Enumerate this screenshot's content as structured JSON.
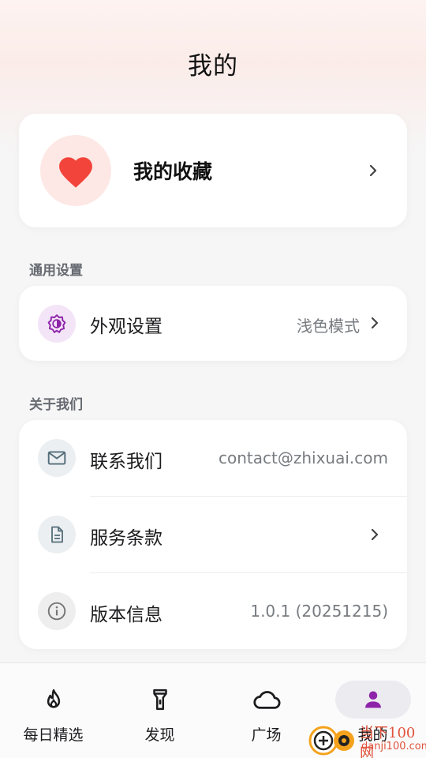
{
  "header": {
    "title": "我的"
  },
  "favorites": {
    "label": "我的收藏",
    "icon": "heart-icon",
    "accent": "#f2443a"
  },
  "general_section": {
    "title": "通用设置",
    "items": [
      {
        "label": "外观设置",
        "value": "浅色模式",
        "icon": "brightness-icon"
      }
    ]
  },
  "about_section": {
    "title": "关于我们",
    "items": [
      {
        "label": "联系我们",
        "value": "contact@zhixuai.com",
        "icon": "mail-icon"
      },
      {
        "label": "服务条款",
        "value": "",
        "icon": "document-icon"
      },
      {
        "label": "版本信息",
        "value": "1.0.1 (20251215)",
        "icon": "info-icon"
      }
    ]
  },
  "tabbar": {
    "tabs": [
      {
        "label": "每日精选",
        "icon": "flame-icon"
      },
      {
        "label": "发现",
        "icon": "flashlight-icon"
      },
      {
        "label": "广场",
        "icon": "cloud-icon"
      },
      {
        "label": "我的",
        "icon": "person-icon",
        "active": true
      }
    ],
    "active_color": "#8e24aa"
  },
  "watermark": {
    "brand": "当下100网",
    "url": "danji100.com"
  }
}
